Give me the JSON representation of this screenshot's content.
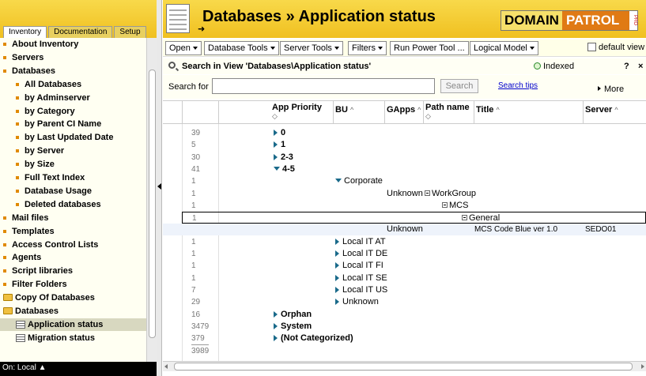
{
  "left": {
    "tabs": [
      "Inventory",
      "Documentation",
      "Setup"
    ],
    "items": [
      {
        "label": "About Inventory",
        "type": "bullet",
        "level": 0
      },
      {
        "label": "Servers",
        "type": "bullet",
        "level": 0
      },
      {
        "label": "Databases",
        "type": "bullet",
        "level": 0
      },
      {
        "label": "All Databases",
        "type": "bullet",
        "level": 1
      },
      {
        "label": "by Adminserver",
        "type": "bullet",
        "level": 1
      },
      {
        "label": "by Category",
        "type": "bullet",
        "level": 1
      },
      {
        "label": "by Parent CI Name",
        "type": "bullet",
        "level": 1
      },
      {
        "label": "by Last Updated Date",
        "type": "bullet",
        "level": 1
      },
      {
        "label": "by Server",
        "type": "bullet",
        "level": 1
      },
      {
        "label": "by Size",
        "type": "bullet",
        "level": 1
      },
      {
        "label": "Full Text Index",
        "type": "bullet",
        "level": 1
      },
      {
        "label": "Database Usage",
        "type": "bullet",
        "level": 1
      },
      {
        "label": "Deleted databases",
        "type": "bullet",
        "level": 1
      },
      {
        "label": "Mail files",
        "type": "bullet",
        "level": 0
      },
      {
        "label": "Templates",
        "type": "bullet",
        "level": 0
      },
      {
        "label": "Access Control Lists",
        "type": "bullet",
        "level": 0
      },
      {
        "label": "Agents",
        "type": "bullet",
        "level": 0
      },
      {
        "label": "Script libraries",
        "type": "bullet",
        "level": 0
      },
      {
        "label": "Filter Folders",
        "type": "bullet",
        "level": 0
      },
      {
        "label": "Copy Of Databases",
        "type": "folder",
        "level": 0
      },
      {
        "label": "Databases",
        "type": "folder",
        "level": 0
      },
      {
        "label": "Application status",
        "type": "view",
        "level": 1,
        "selected": true
      },
      {
        "label": "Migration status",
        "type": "view",
        "level": 1
      }
    ],
    "status": "On: Local ▲"
  },
  "header": {
    "title": "Databases » Application status",
    "arrow": "➜",
    "logo": {
      "part1": "DOMAIN",
      "part2": "PATROL",
      "part3": "PRO"
    }
  },
  "toolbar": {
    "buttons": [
      "Open",
      "Database Tools",
      "Server Tools",
      "Filters",
      "Run Power Tool ...",
      "Logical Model"
    ],
    "default_view": "default view"
  },
  "search": {
    "heading": "Search in View 'Databases\\Application status'",
    "indexed": "Indexed",
    "help": "?",
    "close": "×",
    "label": "Search for",
    "placeholder": "",
    "button": "Search",
    "tips": "Search tips",
    "more": "More"
  },
  "columns": [
    {
      "label": "App Priority",
      "sort": "◇"
    },
    {
      "label": "BU",
      "sort": "^"
    },
    {
      "label": "GApps",
      "sort": "^"
    },
    {
      "label": "Path name",
      "sort": "◇"
    },
    {
      "label": "Title",
      "sort": "^"
    },
    {
      "label": "Server",
      "sort": "^"
    }
  ],
  "rows": [
    {
      "count": "39",
      "text": "0",
      "kind": "cat0",
      "tri": "r"
    },
    {
      "count": "5",
      "text": "1",
      "kind": "cat0",
      "tri": "r"
    },
    {
      "count": "30",
      "text": "2-3",
      "kind": "cat0",
      "tri": "r"
    },
    {
      "count": "41",
      "text": "4-5",
      "kind": "cat0",
      "tri": "d"
    },
    {
      "count": "1",
      "text": "Corporate",
      "kind": "bu",
      "tri": "d"
    },
    {
      "count": "1",
      "text": "Unknown",
      "kind": "gapps",
      "sub": "WorkGroup"
    },
    {
      "count": "1",
      "text": "MCS",
      "kind": "path1"
    },
    {
      "count": "1",
      "text": "General",
      "kind": "path2",
      "selected": true
    },
    {
      "count": "",
      "text": "Unknown",
      "kind": "doc",
      "title": "MCS Code Blue ver 1.0",
      "server": "SEDO01"
    },
    {
      "count": "1",
      "text": "Local IT AT",
      "kind": "bu",
      "tri": "r"
    },
    {
      "count": "1",
      "text": "Local IT DE",
      "kind": "bu",
      "tri": "r"
    },
    {
      "count": "1",
      "text": "Local IT FI",
      "kind": "bu",
      "tri": "r"
    },
    {
      "count": "1",
      "text": "Local IT SE",
      "kind": "bu",
      "tri": "r"
    },
    {
      "count": "7",
      "text": "Local IT US",
      "kind": "bu",
      "tri": "r"
    },
    {
      "count": "29",
      "text": "Unknown",
      "kind": "bu",
      "tri": "r"
    },
    {
      "count": "16",
      "text": "Orphan",
      "kind": "cat0",
      "tri": "r"
    },
    {
      "count": "3479",
      "text": "System",
      "kind": "cat0",
      "tri": "r"
    },
    {
      "count": "379",
      "text": "(Not Categorized)",
      "kind": "cat0",
      "tri": "r"
    },
    {
      "count": "3989",
      "text": "",
      "kind": "total"
    }
  ]
}
